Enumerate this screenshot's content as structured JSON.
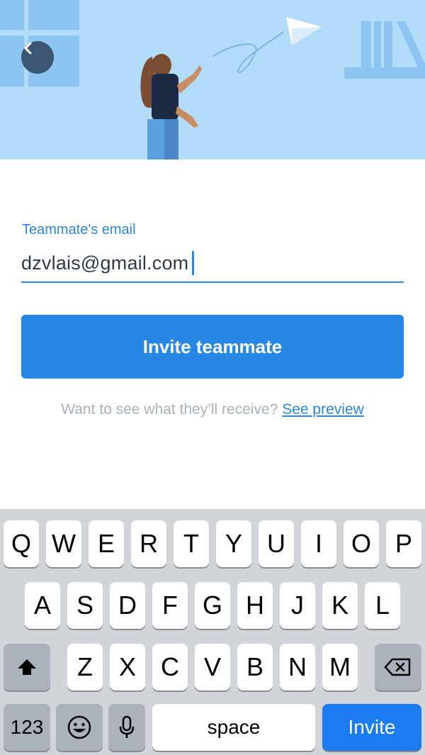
{
  "hero": {
    "illustration": "woman-throwing-paper-plane",
    "background_color": "#b3dcfb"
  },
  "form": {
    "email_label": "Teammate's email",
    "email_value": "dzvlais@gmail.com"
  },
  "invite_button_label": "Invite teammate",
  "preview": {
    "text": "Want to see what they’ll receive?",
    "link_label": "See preview"
  },
  "keyboard": {
    "row1": [
      "Q",
      "W",
      "E",
      "R",
      "T",
      "Y",
      "U",
      "I",
      "O",
      "P"
    ],
    "row2": [
      "A",
      "S",
      "D",
      "F",
      "G",
      "H",
      "J",
      "K",
      "L"
    ],
    "row3": [
      "Z",
      "X",
      "C",
      "V",
      "B",
      "N",
      "M"
    ],
    "numbers_label": "123",
    "space_label": "space",
    "return_label": "Invite"
  },
  "colors": {
    "accent": "#2787e5",
    "keyboard_bg": "#d1d4d9",
    "return_key": "#1a7bf3"
  }
}
